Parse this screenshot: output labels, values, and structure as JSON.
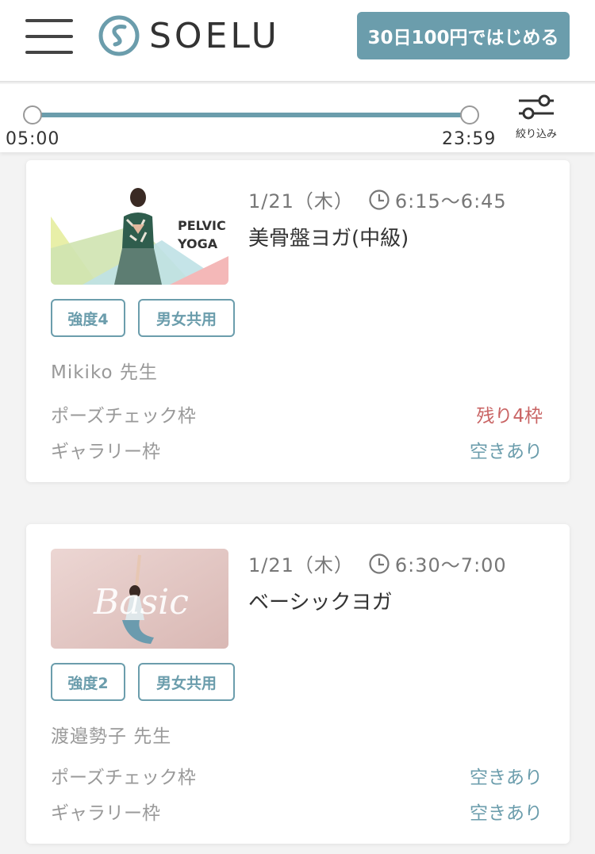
{
  "header": {
    "logo_text": "SOELU",
    "cta_label": "30日100円ではじめる"
  },
  "filter": {
    "time_min": "05:00",
    "time_max": "23:59",
    "filter_label": "絞り込み"
  },
  "classes": [
    {
      "date": "1/21（木）",
      "time": "6:15〜6:45",
      "title": "美骨盤ヨガ(中級)",
      "thumb_text": [
        "PELVIC",
        "YOGA"
      ],
      "tags": [
        "強度4",
        "男女共用"
      ],
      "instructor": "Mikiko 先生",
      "pose_check_label": "ポーズチェック枠",
      "pose_check_status": "残り4枠",
      "gallery_label": "ギャラリー枠",
      "gallery_status": "空きあり"
    },
    {
      "date": "1/21（木）",
      "time": "6:30〜7:00",
      "title": "ベーシックヨガ",
      "thumb_text": [
        "Basic"
      ],
      "tags": [
        "強度2",
        "男女共用"
      ],
      "instructor": "渡邉勢子 先生",
      "pose_check_label": "ポーズチェック枠",
      "pose_check_status": "空きあり",
      "gallery_label": "ギャラリー枠",
      "gallery_status": "空きあり"
    }
  ],
  "colors": {
    "accent": "#6b9dac",
    "limited": "#c96464"
  },
  "icons": {
    "menu": "hamburger-menu-icon",
    "logo": "soelu-logo-icon",
    "filter": "filter-sliders-icon",
    "clock": "clock-icon"
  }
}
